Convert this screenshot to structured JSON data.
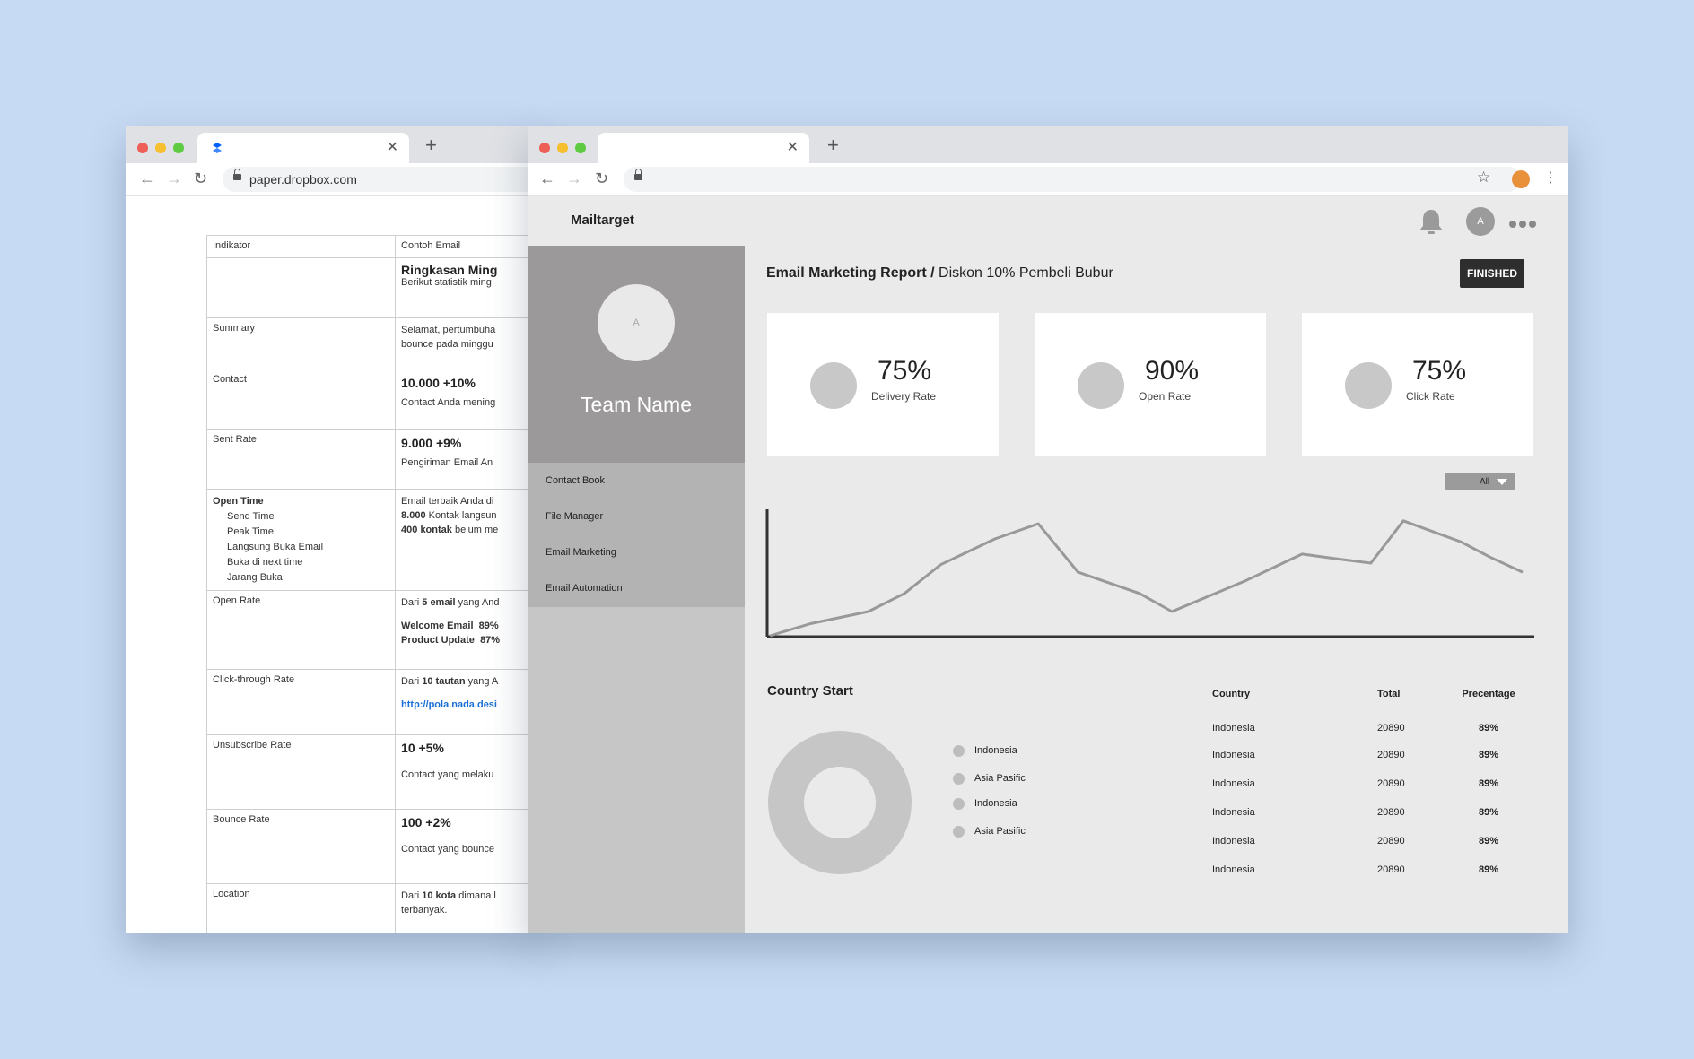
{
  "left_window": {
    "url": "paper.dropbox.com",
    "table": {
      "headers": [
        "Indikator",
        "Contoh Email"
      ],
      "rows": [
        {
          "indicator": "",
          "example_title": "Ringkasan Ming",
          "example_text": "Berikut statistik ming"
        },
        {
          "indicator": "Summary",
          "example_line1": "Selamat, pertumbuha",
          "example_line2": "bounce pada minggu"
        },
        {
          "indicator": "Contact",
          "example_title": "10.000 +10%",
          "example_text": "Contact Anda mening"
        },
        {
          "indicator": "Sent Rate",
          "example_title": "9.000 +9%",
          "example_text": "Pengiriman Email An"
        },
        {
          "indicator": "Open Time",
          "sub_items": [
            "Send Time",
            "Peak Time",
            "Langsung Buka Email",
            "Buka di next time",
            "Jarang Buka"
          ],
          "example_line1": "Email terbaik Anda di",
          "example_bold2": "8.000",
          "example_rest2": " Kontak langsun",
          "example_bold3": "400 kontak",
          "example_rest3": " belum me"
        },
        {
          "indicator": "Open Rate",
          "example_pre": "Dari ",
          "example_bold": "5 email",
          "example_post": " yang And",
          "list": [
            {
              "label": "Welcome Email",
              "value": "89%"
            },
            {
              "label": "Product Update",
              "value": "87%"
            }
          ]
        },
        {
          "indicator": "Click-through Rate",
          "example_pre": "Dari ",
          "example_bold": "10 tautan",
          "example_post": " yang A",
          "link": "http://pola.nada.desi"
        },
        {
          "indicator": "Unsubscribe Rate",
          "example_title": "10 +5%",
          "example_text": "Contact yang melaku"
        },
        {
          "indicator": "Bounce Rate",
          "example_title": "100 +2%",
          "example_text": "Contact yang bounce"
        },
        {
          "indicator": "Location",
          "example_pre": "Dari ",
          "example_bold": "10 kota",
          "example_post": " dimana l",
          "example_line2": "terbanyak."
        }
      ]
    }
  },
  "right_window": {
    "brand": "Mailtarget",
    "header_avatar_letter": "A",
    "sidebar": {
      "avatar_letter": "A",
      "team_name": "Team Name",
      "menu": [
        "Contact Book",
        "File Manager",
        "Email Marketing",
        "Email Automation"
      ]
    },
    "report": {
      "title_bold": "Email Marketing Report /",
      "title_rest": " Diskon 10% Pembeli Bubur",
      "status": "FINISHED"
    },
    "stats": [
      {
        "value": "75%",
        "label": "Delivery Rate"
      },
      {
        "value": "90%",
        "label": "Open Rate"
      },
      {
        "value": "75%",
        "label": "Click Rate"
      }
    ],
    "filter": {
      "selected": "All"
    },
    "chart_data": {
      "type": "line",
      "series": [
        {
          "values": [
            0,
            8,
            16,
            28,
            47,
            64,
            74,
            42,
            28,
            16,
            36,
            54,
            51,
            48,
            76,
            62,
            52,
            42
          ]
        }
      ],
      "grid": false,
      "legend": "none"
    },
    "country": {
      "title": "Country Start",
      "legend": [
        "Indonesia",
        "Asia Pasific",
        "Indonesia",
        "Asia Pasific"
      ],
      "table_headers": [
        "Country",
        "Total",
        "Precentage"
      ],
      "rows": [
        {
          "country": "Indonesia",
          "total": "20890",
          "pct": "89%"
        },
        {
          "country": "Indonesia",
          "total": "20890",
          "pct": "89%"
        },
        {
          "country": "Indonesia",
          "total": "20890",
          "pct": "89%"
        },
        {
          "country": "Indonesia",
          "total": "20890",
          "pct": "89%"
        },
        {
          "country": "Indonesia",
          "total": "20890",
          "pct": "89%"
        },
        {
          "country": "Indonesia",
          "total": "20890",
          "pct": "89%"
        }
      ]
    }
  }
}
